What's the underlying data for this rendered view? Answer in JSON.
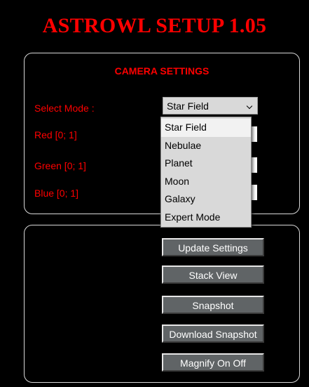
{
  "app": {
    "title": "ASTROWL SETUP 1.05"
  },
  "camera_settings": {
    "heading": "CAMERA SETTINGS",
    "select_mode_label": "Select Mode :",
    "select_mode_value": "Star Field",
    "red_label": "Red [0; 1]",
    "green_label": "Green [0; 1]",
    "blue_label": "Blue [0; 1]",
    "mode_options": [
      "Star Field",
      "Nebulae",
      "Planet",
      "Moon",
      "Galaxy",
      "Expert Mode"
    ],
    "highlighted_option": "Star Field"
  },
  "actions": {
    "update_settings": "Update Settings",
    "stack_view": "Stack View",
    "snapshot": "Snapshot",
    "download_snapshot": "Download Snapshot",
    "magnify": "Magnify On Off"
  },
  "colors": {
    "label_red": "#ff0000",
    "background": "#000000",
    "button_gray": "#606466",
    "select_gray": "#d9d9d9"
  }
}
